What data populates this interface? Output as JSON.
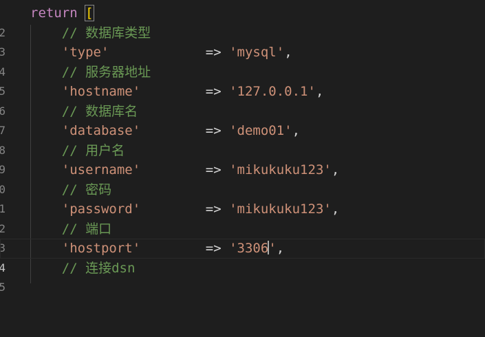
{
  "gutter": [
    "2",
    "3",
    "4",
    "5",
    "6",
    "7",
    "8",
    "9",
    "0",
    "1",
    "2",
    "3",
    "4",
    "5"
  ],
  "code": {
    "return_kw": "return",
    "open_bracket": "[",
    "arrow": "=>",
    "comma": ",",
    "comments": {
      "db_type": "// 数据库类型",
      "server": "// 服务器地址",
      "db_name": "// 数据库名",
      "user": "// 用户名",
      "pass": "// 密码",
      "port": "// 端口",
      "dsn": "// 连接dsn"
    },
    "entries": {
      "type": {
        "key": "'type'",
        "value": "'mysql'"
      },
      "hostname": {
        "key": "'hostname'",
        "value": "'127.0.0.1'"
      },
      "database": {
        "key": "'database'",
        "value": "'demo01'"
      },
      "username": {
        "key": "'username'",
        "value": "'mikukuku123'"
      },
      "password": {
        "key": "'password'",
        "value": "'mikukuku123'"
      },
      "hostport": {
        "key": "'hostport'",
        "value_before_cursor": "'3306",
        "value_after_cursor": "'"
      }
    }
  },
  "colors": {
    "background": "#1e1e1e",
    "keyword": "#c586c0",
    "bracket": "#ffd700",
    "comment": "#6a9955",
    "string": "#ce9178",
    "text": "#d4d4d4",
    "line_number": "#858585"
  }
}
